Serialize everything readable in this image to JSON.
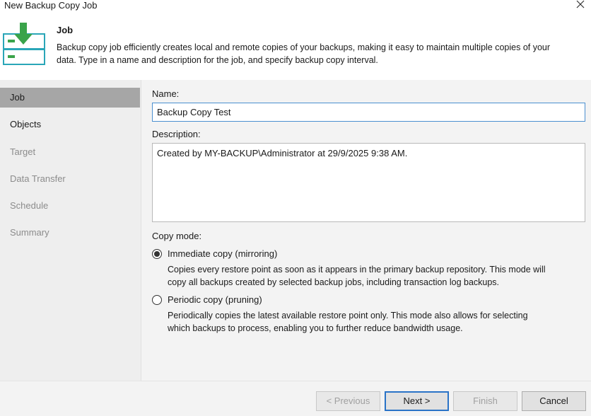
{
  "window": {
    "title": "New Backup Copy Job"
  },
  "header": {
    "title": "Job",
    "description_line1": "Backup copy job efficiently creates local and remote copies of your backups, making it easy to maintain multiple copies of your",
    "description_line2": "data. Type in a name and description for the job, and specify backup copy interval."
  },
  "sidebar": {
    "items": [
      {
        "label": "Job",
        "state": "active"
      },
      {
        "label": "Objects",
        "state": "enabled"
      },
      {
        "label": "Target",
        "state": "disabled"
      },
      {
        "label": "Data Transfer",
        "state": "disabled"
      },
      {
        "label": "Schedule",
        "state": "disabled"
      },
      {
        "label": "Summary",
        "state": "disabled"
      }
    ]
  },
  "form": {
    "name_label": "Name:",
    "name_value": "Backup Copy Test",
    "description_label": "Description:",
    "description_value": "Created by MY-BACKUP\\Administrator at 29/9/2025 9:38 AM.",
    "copy_mode_label": "Copy mode:",
    "modes": [
      {
        "label": "Immediate copy (mirroring)",
        "checked": true,
        "desc_line1": "Copies every restore point as soon as it appears in the primary backup repository. This mode will",
        "desc_line2": "copy all backups created by selected backup jobs, including transaction log backups."
      },
      {
        "label": "Periodic copy (pruning)",
        "checked": false,
        "desc_line1": "Periodically copies the latest available restore point only. This mode also allows for selecting",
        "desc_line2": "which backups to process, enabling you to further reduce bandwidth usage."
      }
    ]
  },
  "footer": {
    "previous_label": "< Previous",
    "next_label": "Next >",
    "finish_label": "Finish",
    "cancel_label": "Cancel"
  },
  "colors": {
    "sidebar_bg": "#eeeeee",
    "sidebar_active": "#a6a6a6",
    "content_bg": "#f3f3f3",
    "accent_blue": "#2a73c7",
    "icon_green": "#3aa34a",
    "icon_teal": "#2aa6b8"
  },
  "icons": {
    "header": "backup-copy-job-icon",
    "close": "close-icon"
  }
}
